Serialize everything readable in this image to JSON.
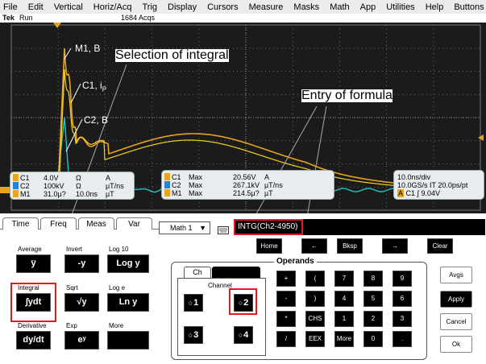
{
  "menu": [
    "File",
    "Edit",
    "Vertical",
    "Horiz/Acq",
    "Trig",
    "Display",
    "Cursors",
    "Measure",
    "Masks",
    "Math",
    "App",
    "Utilities",
    "Help",
    "Buttons"
  ],
  "status": {
    "brand": "Tek",
    "state": "Run",
    "acqs": "1684 Acqs"
  },
  "annotations": {
    "selection": "Selection of integral",
    "entry": "Entry of formula",
    "m1": "M1, B",
    "c1": "C1, i",
    "c1_sub": "P",
    "c2": "C2, B"
  },
  "markers": {
    "left": "M",
    "trigger": "◆"
  },
  "readout_left": [
    {
      "ch": "C1",
      "val": "4.0V",
      "unit": "Ω",
      "extra": "A",
      "color": "#e8a41c"
    },
    {
      "ch": "C2",
      "val": "100kV",
      "unit": "Ω",
      "extra": "µT/ns",
      "color": "#2a7fd6"
    },
    {
      "ch": "M1",
      "val": "31.0µ?",
      "unit": "10.0ns",
      "extra": "µT",
      "color": "#e8a41c"
    }
  ],
  "readout_mid": [
    {
      "ch": "C1",
      "label": "Max",
      "val": "20.56V",
      "unit": "A"
    },
    {
      "ch": "C2",
      "label": "Max",
      "val": "267.1kV",
      "unit": "µT/ns"
    },
    {
      "ch": "M1",
      "label": "Max",
      "val": "214.5µ?",
      "unit": "µT"
    }
  ],
  "readout_right": {
    "timebase": "10.0ns/div",
    "rate": "10.0GS/s IT 20.0ps/pt",
    "trig_letter": "A",
    "trig_ch": "C1",
    "trig_level": "∫ 9.04V"
  },
  "tabs": [
    "Time",
    "Freq",
    "Meas",
    "Var"
  ],
  "math_select": "Math 1",
  "formula": "INTG(Ch2-4950)",
  "functions": [
    {
      "label": "Average",
      "btn": "y̅"
    },
    {
      "label": "Invert",
      "btn": "-y"
    },
    {
      "label": "Log 10",
      "btn": "Log y"
    },
    {
      "label": "Integral",
      "btn": "∫ydt"
    },
    {
      "label": "Sqrt",
      "btn": "√y"
    },
    {
      "label": "Log e",
      "btn": "Ln y"
    },
    {
      "label": "Derivative",
      "btn": "dy/dt"
    },
    {
      "label": "Exp",
      "btn": "eʸ"
    },
    {
      "label": "More",
      "btn": ""
    }
  ],
  "edit_buttons": [
    "Home",
    "←",
    "Bksp",
    "→",
    "Clear"
  ],
  "operands_title": "Operands",
  "operand_tabs": [
    "Ch"
  ],
  "channel_label": "Channel",
  "channels": [
    "1",
    "2",
    "3",
    "4"
  ],
  "keypad": [
    [
      "+",
      "(",
      "7",
      "8",
      "9"
    ],
    [
      "-",
      ")",
      "4",
      "5",
      "6"
    ],
    [
      "*",
      "CHS",
      "1",
      "2",
      "3"
    ],
    [
      "/",
      "EEX",
      "More",
      "0",
      "."
    ]
  ],
  "side_buttons": [
    "Avgs",
    "Apply",
    "Cancel",
    "Ok"
  ],
  "colors": {
    "c1": "#e8a41c",
    "c2": "#1fc4c8",
    "m1": "#f2d21c",
    "grid": "#6a6a6a",
    "highlight": "#e01b1b"
  }
}
